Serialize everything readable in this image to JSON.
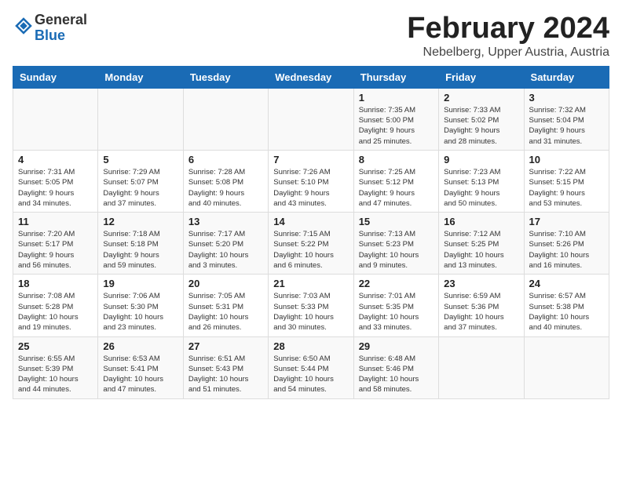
{
  "header": {
    "logo_general": "General",
    "logo_blue": "Blue",
    "month_title": "February 2024",
    "location": "Nebelberg, Upper Austria, Austria"
  },
  "calendar": {
    "days_of_week": [
      "Sunday",
      "Monday",
      "Tuesday",
      "Wednesday",
      "Thursday",
      "Friday",
      "Saturday"
    ],
    "weeks": [
      [
        {
          "day": "",
          "info": ""
        },
        {
          "day": "",
          "info": ""
        },
        {
          "day": "",
          "info": ""
        },
        {
          "day": "",
          "info": ""
        },
        {
          "day": "1",
          "info": "Sunrise: 7:35 AM\nSunset: 5:00 PM\nDaylight: 9 hours\nand 25 minutes."
        },
        {
          "day": "2",
          "info": "Sunrise: 7:33 AM\nSunset: 5:02 PM\nDaylight: 9 hours\nand 28 minutes."
        },
        {
          "day": "3",
          "info": "Sunrise: 7:32 AM\nSunset: 5:04 PM\nDaylight: 9 hours\nand 31 minutes."
        }
      ],
      [
        {
          "day": "4",
          "info": "Sunrise: 7:31 AM\nSunset: 5:05 PM\nDaylight: 9 hours\nand 34 minutes."
        },
        {
          "day": "5",
          "info": "Sunrise: 7:29 AM\nSunset: 5:07 PM\nDaylight: 9 hours\nand 37 minutes."
        },
        {
          "day": "6",
          "info": "Sunrise: 7:28 AM\nSunset: 5:08 PM\nDaylight: 9 hours\nand 40 minutes."
        },
        {
          "day": "7",
          "info": "Sunrise: 7:26 AM\nSunset: 5:10 PM\nDaylight: 9 hours\nand 43 minutes."
        },
        {
          "day": "8",
          "info": "Sunrise: 7:25 AM\nSunset: 5:12 PM\nDaylight: 9 hours\nand 47 minutes."
        },
        {
          "day": "9",
          "info": "Sunrise: 7:23 AM\nSunset: 5:13 PM\nDaylight: 9 hours\nand 50 minutes."
        },
        {
          "day": "10",
          "info": "Sunrise: 7:22 AM\nSunset: 5:15 PM\nDaylight: 9 hours\nand 53 minutes."
        }
      ],
      [
        {
          "day": "11",
          "info": "Sunrise: 7:20 AM\nSunset: 5:17 PM\nDaylight: 9 hours\nand 56 minutes."
        },
        {
          "day": "12",
          "info": "Sunrise: 7:18 AM\nSunset: 5:18 PM\nDaylight: 9 hours\nand 59 minutes."
        },
        {
          "day": "13",
          "info": "Sunrise: 7:17 AM\nSunset: 5:20 PM\nDaylight: 10 hours\nand 3 minutes."
        },
        {
          "day": "14",
          "info": "Sunrise: 7:15 AM\nSunset: 5:22 PM\nDaylight: 10 hours\nand 6 minutes."
        },
        {
          "day": "15",
          "info": "Sunrise: 7:13 AM\nSunset: 5:23 PM\nDaylight: 10 hours\nand 9 minutes."
        },
        {
          "day": "16",
          "info": "Sunrise: 7:12 AM\nSunset: 5:25 PM\nDaylight: 10 hours\nand 13 minutes."
        },
        {
          "day": "17",
          "info": "Sunrise: 7:10 AM\nSunset: 5:26 PM\nDaylight: 10 hours\nand 16 minutes."
        }
      ],
      [
        {
          "day": "18",
          "info": "Sunrise: 7:08 AM\nSunset: 5:28 PM\nDaylight: 10 hours\nand 19 minutes."
        },
        {
          "day": "19",
          "info": "Sunrise: 7:06 AM\nSunset: 5:30 PM\nDaylight: 10 hours\nand 23 minutes."
        },
        {
          "day": "20",
          "info": "Sunrise: 7:05 AM\nSunset: 5:31 PM\nDaylight: 10 hours\nand 26 minutes."
        },
        {
          "day": "21",
          "info": "Sunrise: 7:03 AM\nSunset: 5:33 PM\nDaylight: 10 hours\nand 30 minutes."
        },
        {
          "day": "22",
          "info": "Sunrise: 7:01 AM\nSunset: 5:35 PM\nDaylight: 10 hours\nand 33 minutes."
        },
        {
          "day": "23",
          "info": "Sunrise: 6:59 AM\nSunset: 5:36 PM\nDaylight: 10 hours\nand 37 minutes."
        },
        {
          "day": "24",
          "info": "Sunrise: 6:57 AM\nSunset: 5:38 PM\nDaylight: 10 hours\nand 40 minutes."
        }
      ],
      [
        {
          "day": "25",
          "info": "Sunrise: 6:55 AM\nSunset: 5:39 PM\nDaylight: 10 hours\nand 44 minutes."
        },
        {
          "day": "26",
          "info": "Sunrise: 6:53 AM\nSunset: 5:41 PM\nDaylight: 10 hours\nand 47 minutes."
        },
        {
          "day": "27",
          "info": "Sunrise: 6:51 AM\nSunset: 5:43 PM\nDaylight: 10 hours\nand 51 minutes."
        },
        {
          "day": "28",
          "info": "Sunrise: 6:50 AM\nSunset: 5:44 PM\nDaylight: 10 hours\nand 54 minutes."
        },
        {
          "day": "29",
          "info": "Sunrise: 6:48 AM\nSunset: 5:46 PM\nDaylight: 10 hours\nand 58 minutes."
        },
        {
          "day": "",
          "info": ""
        },
        {
          "day": "",
          "info": ""
        }
      ]
    ]
  }
}
